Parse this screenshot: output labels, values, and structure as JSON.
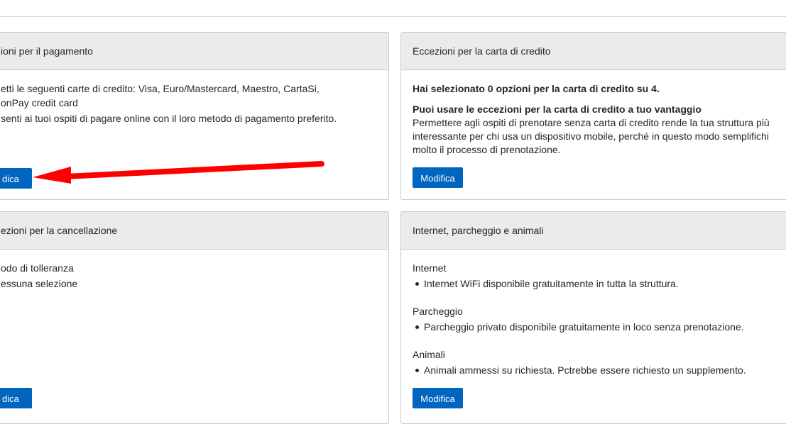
{
  "page": {
    "top_fragment": "·· ·· · ··"
  },
  "cards": {
    "payment": {
      "title": "ioni per il pagamento",
      "line1": "etti le seguenti carte di credito: Visa, Euro/Mastercard, Maestro, CartaSi,",
      "line2": "onPay credit card",
      "line3": "senti ai tuoi ospiti di pagare online con il loro metodo di pagamento preferito.",
      "button": "dica"
    },
    "credit_card": {
      "title": "Eccezioni per la carta di credito",
      "summary": "Hai selezionato 0 opzioni per la carta di credito su 4.",
      "heading": "Puoi usare le eccezioni per la carta di credito a tuo vantaggio",
      "text1": "Permettere agli ospiti di prenotare senza carta di credito rende la tua struttura più",
      "text2": "interessante per chi usa un dispositivo mobile, perché in questo modo semplifichi",
      "text3": "molto il processo di prenotazione.",
      "button": "Modifica"
    },
    "cancellation": {
      "title": "ezioni per la cancellazione",
      "label": "odo di tolleranza",
      "value": "essuna selezione",
      "button": "dica"
    },
    "amenities": {
      "title": "Internet, parcheggio e animali",
      "internet_label": "Internet",
      "internet_item": "Internet WiFi disponibile gratuitamente in tutta la struttura.",
      "parking_label": "Parcheggio",
      "parking_item": "Parcheggio privato disponibile gratuitamente in loco senza prenotazione.",
      "pets_label": "Animali",
      "pets_item": "Animali ammessi su richiesta. Pctrebbe essere richiesto un supplemento.",
      "button": "Modifica"
    }
  },
  "annotation": {
    "color": "#ff0000"
  }
}
